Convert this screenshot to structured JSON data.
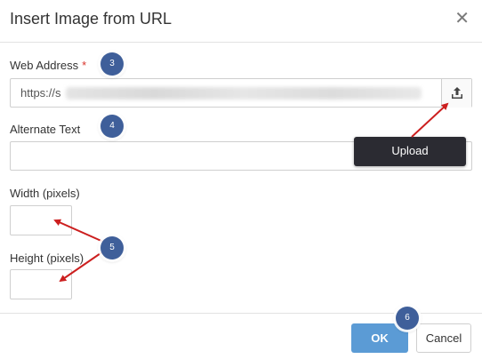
{
  "dialog": {
    "title": "Insert Image from URL",
    "close_icon": "close-icon"
  },
  "fields": {
    "web_address": {
      "label": "Web Address",
      "required_mark": "*",
      "value_prefix": "https://s"
    },
    "alternate_text": {
      "label": "Alternate Text",
      "value": ""
    },
    "width": {
      "label": "Width (pixels)",
      "value": ""
    },
    "height": {
      "label": "Height (pixels)",
      "value": ""
    }
  },
  "upload": {
    "icon": "upload-icon",
    "tooltip": "Upload"
  },
  "buttons": {
    "ok": "OK",
    "cancel": "Cancel"
  },
  "annotations": [
    "3",
    "4",
    "5",
    "6"
  ],
  "colors": {
    "ok_button": "#5b9bd5",
    "badge": "#3f5f9a",
    "arrow": "#cc1f1f",
    "tooltip_bg": "#2b2b32"
  }
}
